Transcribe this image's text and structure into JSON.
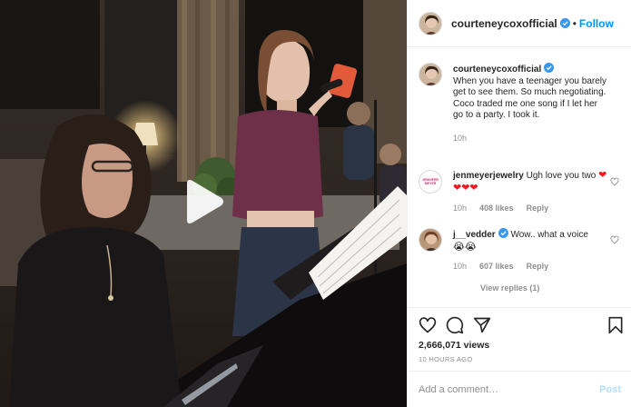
{
  "post": {
    "author": "courteneycoxofficial",
    "follow_label": "Follow",
    "separator": "•",
    "views": "2,666,071 views",
    "time_ago": "10 HOURS AGO",
    "caption": {
      "username": "courteneycoxofficial",
      "text": "When you have a teenager you barely get to see them. So much negotiating. Coco traded me one song if I let her go to a party. I took it.",
      "time": "10h"
    }
  },
  "comments": [
    {
      "username": "jenmeyerjewelry",
      "text": "Ugh love you two",
      "emoji": "❤❤❤❤",
      "time": "10h",
      "likes": "408 likes",
      "reply_label": "Reply",
      "avatar_text": "JENNIFER MEYER"
    },
    {
      "username": "j__vedder",
      "text": "Wow.. what a voice",
      "emoji": "😭😭",
      "time": "10h",
      "likes": "607 likes",
      "reply_label": "Reply"
    }
  ],
  "view_replies_label": "View replies (1)",
  "add_comment": {
    "placeholder": "Add a comment…",
    "post_label": "Post"
  },
  "colors": {
    "accent": "#0095f6",
    "post_disabled": "#b2dffc",
    "heart_red": "#ed1c24",
    "verified": "#3897f0"
  },
  "icons": {
    "play": "play-icon",
    "like": "heart-icon",
    "comment": "comment-icon",
    "share": "share-icon",
    "save": "bookmark-icon",
    "verified": "verified-badge-icon"
  }
}
